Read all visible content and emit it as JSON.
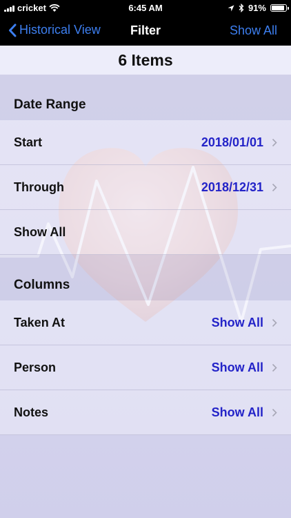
{
  "status_bar": {
    "carrier": "cricket",
    "time": "6:45 AM",
    "battery_percent": "91%",
    "battery_level": 0.91
  },
  "nav": {
    "back_label": "Historical View",
    "title": "Filter",
    "right_action": "Show All",
    "accent_color": "#3d7ff0"
  },
  "summary": {
    "items_count_label": "6 Items"
  },
  "date_range": {
    "header": "Date Range",
    "rows": [
      {
        "label": "Start",
        "value": "2018/01/01"
      },
      {
        "label": "Through",
        "value": "2018/12/31"
      },
      {
        "label": "Show All",
        "value": ""
      }
    ]
  },
  "columns": {
    "header": "Columns",
    "rows": [
      {
        "label": "Taken At",
        "value": "Show All"
      },
      {
        "label": "Person",
        "value": "Show All"
      },
      {
        "label": "Notes",
        "value": "Show All"
      }
    ]
  },
  "colors": {
    "value_text": "#2323c8",
    "background": "#d8d6ee"
  },
  "icons": [
    "wifi-icon",
    "location-arrow-icon",
    "bluetooth-icon",
    "battery-icon",
    "chevron-left-icon",
    "chevron-right-icon",
    "heart-illustration"
  ]
}
